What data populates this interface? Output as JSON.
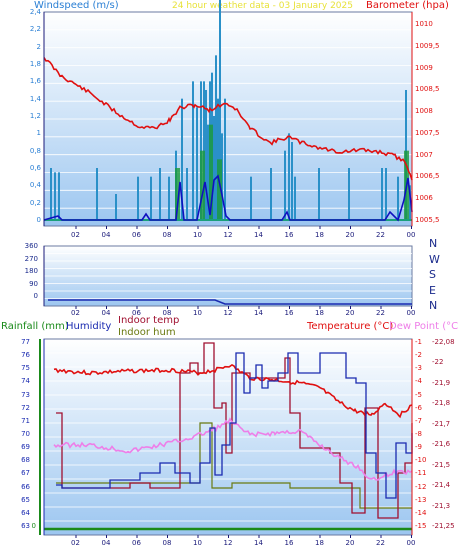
{
  "top": {
    "left_title": "Windspeed (m/s)",
    "center_title": "24 hour weather data - 03 January 2025",
    "right_title": "Barometer (hpa)",
    "left_ticks": [
      "2,4",
      "2,2",
      "2",
      "1,8",
      "1,6",
      "1,4",
      "1,2",
      "1",
      "0,8",
      "0,6",
      "0,4",
      "0,2",
      "0"
    ],
    "right_ticks": [
      "1010",
      "1009,5",
      "1009",
      "1008,5",
      "1008",
      "1007,5",
      "1007",
      "1006,5",
      "1006",
      "1005,5"
    ],
    "x_ticks": [
      "02",
      "04",
      "06",
      "08",
      "10",
      "12",
      "14",
      "16",
      "18",
      "20",
      "22",
      "00"
    ]
  },
  "mid": {
    "left_ticks": [
      "360",
      "270",
      "180",
      "90",
      "0"
    ],
    "dir_labels": [
      "N",
      "W",
      "S",
      "E",
      "N"
    ],
    "x_ticks": [
      "02",
      "04",
      "06",
      "08",
      "10",
      "12",
      "14",
      "16",
      "18",
      "20",
      "22",
      "00"
    ]
  },
  "bottom": {
    "label_rain": "Rainfall (mm)",
    "label_humidity": "Humidity",
    "label_indoor_temp": "Indoor temp",
    "label_indoor_hum": "Indoor hum",
    "label_temperature": "Temperature (°C)",
    "label_dewpoint": "Dew Point (°C)",
    "hum_ticks": [
      "77",
      "76",
      "75",
      "74",
      "73",
      "72",
      "71",
      "70",
      "69",
      "68",
      "67",
      "66",
      "65",
      "64",
      "63"
    ],
    "rain_ticks": [
      "0"
    ],
    "temp_ticks": [
      "-1",
      "-2",
      "-3",
      "-4",
      "-5",
      "-6",
      "-7",
      "-8",
      "-9",
      "-10",
      "-11",
      "-12",
      "-13",
      "-14",
      "-15"
    ],
    "dew_ticks": [
      "-22,08",
      "-22",
      "-21,9",
      "-21,8",
      "-21,7",
      "-21,6",
      "-21,5",
      "-21,4",
      "-21,3",
      "-21,25"
    ],
    "x_ticks": [
      "02",
      "04",
      "06",
      "08",
      "10",
      "12",
      "14",
      "16",
      "18",
      "20",
      "22",
      "00"
    ]
  },
  "colors": {
    "wind_left": "#2a7fd4",
    "title_center": "#e8e23a",
    "barometer": "#e01010",
    "rain": "#1a8a1a",
    "humidity": "#1a2ab0",
    "indoor_temp": "#a01030",
    "indoor_hum": "#6a7a10",
    "temperature": "#e01010",
    "dewpoint": "#ee7ee8"
  }
}
